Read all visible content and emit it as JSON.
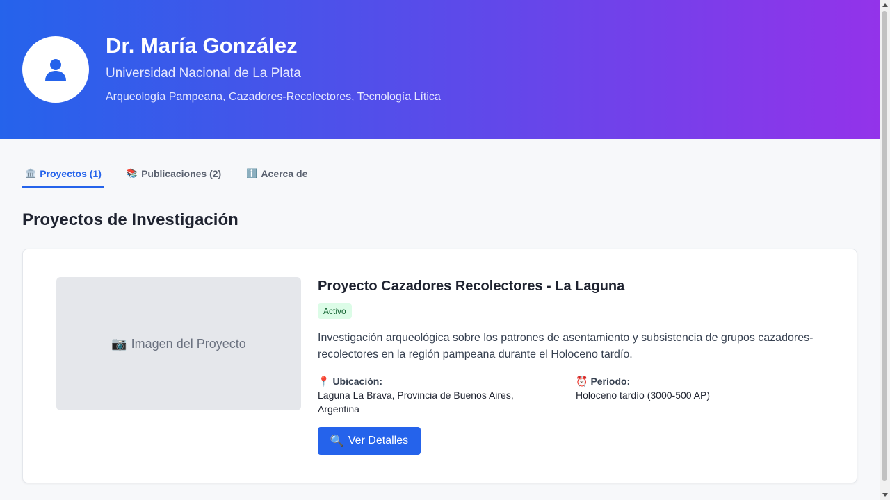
{
  "profile": {
    "name": "Dr. María González",
    "university": "Universidad Nacional de La Plata",
    "areas": "Arqueología Pampeana, Cazadores-Recolectores, Tecnología Lítica",
    "avatar_icon": "user-icon"
  },
  "tabs": [
    {
      "icon": "🏛️",
      "label": "Proyectos (1)",
      "active": true
    },
    {
      "icon": "📚",
      "label": "Publicaciones (2)",
      "active": false
    },
    {
      "icon": "ℹ️",
      "label": "Acerca de",
      "active": false
    }
  ],
  "section": {
    "title": "Proyectos de Investigación"
  },
  "project": {
    "image_icon": "📷",
    "image_label": "Imagen del Proyecto",
    "title": "Proyecto Cazadores Recolectores - La Laguna",
    "status": "Activo",
    "description": "Investigación arqueológica sobre los patrones de asentamiento y subsistencia de grupos cazadores-recolectores en la región pampeana durante el Holoceno tardío.",
    "location_icon": "📍",
    "location_label": "Ubicación:",
    "location_value": "Laguna La Brava, Provincia de Buenos Aires, Argentina",
    "period_icon": "⏰",
    "period_label": "Período:",
    "period_value": "Holoceno tardío (3000-500 AP)",
    "button_icon": "🔍",
    "button_label": "Ver Detalles"
  },
  "colors": {
    "accent": "#2563eb",
    "gradient_start": "#2563eb",
    "gradient_end": "#9333ea",
    "badge_bg": "#dcfce7",
    "badge_text": "#166534"
  }
}
